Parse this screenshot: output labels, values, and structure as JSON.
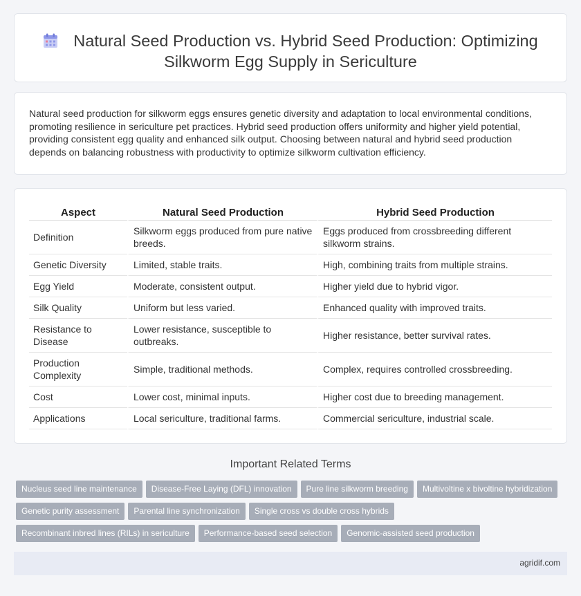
{
  "header": {
    "icon": "calendar-icon",
    "title_line1": "Natural Seed Production vs. Hybrid Seed Production: Optimizing",
    "title_line2": "Silkworm Egg Supply in Sericulture"
  },
  "summary": "Natural seed production for silkworm eggs ensures genetic diversity and adaptation to local environmental conditions, promoting resilience in sericulture pet practices. Hybrid seed production offers uniformity and higher yield potential, providing consistent egg quality and enhanced silk output. Choosing between natural and hybrid seed production depends on balancing robustness with productivity to optimize silkworm cultivation efficiency.",
  "table": {
    "headers": [
      "Aspect",
      "Natural Seed Production",
      "Hybrid Seed Production"
    ],
    "rows": [
      [
        "Definition",
        "Silkworm eggs produced from pure native breeds.",
        "Eggs produced from crossbreeding different silkworm strains."
      ],
      [
        "Genetic Diversity",
        "Limited, stable traits.",
        "High, combining traits from multiple strains."
      ],
      [
        "Egg Yield",
        "Moderate, consistent output.",
        "Higher yield due to hybrid vigor."
      ],
      [
        "Silk Quality",
        "Uniform but less varied.",
        "Enhanced quality with improved traits."
      ],
      [
        "Resistance to Disease",
        "Lower resistance, susceptible to outbreaks.",
        "Higher resistance, better survival rates."
      ],
      [
        "Production Complexity",
        "Simple, traditional methods.",
        "Complex, requires controlled crossbreeding."
      ],
      [
        "Cost",
        "Lower cost, minimal inputs.",
        "Higher cost due to breeding management."
      ],
      [
        "Applications",
        "Local sericulture, traditional farms.",
        "Commercial sericulture, industrial scale."
      ]
    ]
  },
  "related": {
    "title": "Important Related Terms",
    "tags": [
      "Nucleus seed line maintenance",
      "Disease-Free Laying (DFL) innovation",
      "Pure line silkworm breeding",
      "Multivoltine x bivoltine hybridization",
      "Genetic purity assessment",
      "Parental line synchronization",
      "Single cross vs double cross hybrids",
      "Recombinant inbred lines (RILs) in sericulture",
      "Performance-based seed selection",
      "Genomic-assisted seed production"
    ]
  },
  "footer": {
    "site": "agridif.com"
  }
}
